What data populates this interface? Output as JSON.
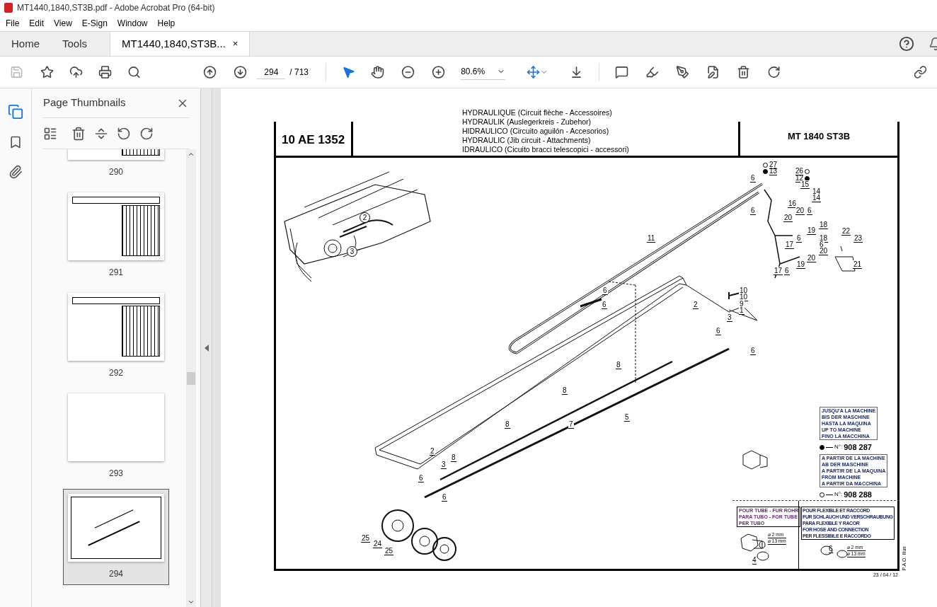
{
  "window": {
    "title": "MT1440,1840,ST3B.pdf - Adobe Acrobat Pro (64-bit)"
  },
  "menu": [
    "File",
    "Edit",
    "View",
    "E-Sign",
    "Window",
    "Help"
  ],
  "tabs": [
    {
      "label": "Home",
      "selected": false
    },
    {
      "label": "Tools",
      "selected": false
    },
    {
      "label": "MT1440,1840,ST3B...",
      "selected": true,
      "close": "×"
    }
  ],
  "toolbar": {
    "page": "294",
    "page_total": "/ 713",
    "zoom": "80.6%"
  },
  "sidebar": {
    "title": "Page Thumbnails",
    "thumbnails": [
      {
        "label": "290",
        "kind": "table",
        "selected": false
      },
      {
        "label": "291",
        "kind": "table",
        "selected": false
      },
      {
        "label": "292",
        "kind": "table",
        "selected": false
      },
      {
        "label": "293",
        "kind": "blank",
        "selected": false
      },
      {
        "label": "294",
        "kind": "drawing",
        "selected": true
      }
    ]
  },
  "document": {
    "ref": "10 AE 1352",
    "titles": [
      "HYDRAULIQUE (Circuit flèche - Accessoires)",
      "HYDRAULIK (Auslegerkreis - Zubehor)",
      "HIDRAULICO (Circuito aguilón - Accesorios)",
      "HYDRAULIC (Jib circuit - Attachments)",
      "IDRAULICO (Cicuito bracci telescopici - accessori)"
    ],
    "model": "MT 1840 ST3B",
    "part_labels": [
      {
        "text": "2",
        "kind": "circled"
      },
      {
        "text": "3",
        "kind": "circled"
      },
      {
        "text": "11",
        "kind": "plain"
      },
      {
        "text": "6",
        "kind": "plain"
      },
      {
        "text": "6",
        "kind": "plain"
      },
      {
        "text": "27",
        "kind": "open_dot"
      },
      {
        "text": "13",
        "kind": "filled_dot"
      },
      {
        "text": "26",
        "kind": "open_dot",
        "dot_after": true
      },
      {
        "text": "12",
        "kind": "filled_dot",
        "dot_after": true
      },
      {
        "text": "15",
        "kind": "plain"
      },
      {
        "text": "14",
        "kind": "plain"
      },
      {
        "text": "14",
        "kind": "plain"
      },
      {
        "text": "16",
        "kind": "plain"
      },
      {
        "text": "20",
        "kind": "plain"
      },
      {
        "text": "6",
        "kind": "plain"
      },
      {
        "text": "20",
        "kind": "plain"
      },
      {
        "text": "18",
        "kind": "plain"
      },
      {
        "text": "19",
        "kind": "plain"
      },
      {
        "text": "6",
        "kind": "plain"
      },
      {
        "text": "18",
        "kind": "plain"
      },
      {
        "text": "6",
        "kind": "plain"
      },
      {
        "text": "17",
        "kind": "plain"
      },
      {
        "text": "20",
        "kind": "plain"
      },
      {
        "text": "20",
        "kind": "plain"
      },
      {
        "text": "19",
        "kind": "plain"
      },
      {
        "text": "17",
        "kind": "plain"
      },
      {
        "text": "6",
        "kind": "plain"
      },
      {
        "text": "22",
        "kind": "plain"
      },
      {
        "text": "23",
        "kind": "plain"
      },
      {
        "text": "21",
        "kind": "plain"
      },
      {
        "text": "10",
        "kind": "plain"
      },
      {
        "text": "10",
        "kind": "plain"
      },
      {
        "text": "9",
        "kind": "plain"
      },
      {
        "text": "1",
        "kind": "plain"
      },
      {
        "text": "6",
        "kind": "plain"
      },
      {
        "text": "6",
        "kind": "plain"
      },
      {
        "text": "2",
        "kind": "plain"
      },
      {
        "text": "3",
        "kind": "plain"
      },
      {
        "text": "6",
        "kind": "plain"
      },
      {
        "text": "6",
        "kind": "plain"
      },
      {
        "text": "8",
        "kind": "plain"
      },
      {
        "text": "8",
        "kind": "plain"
      },
      {
        "text": "5",
        "kind": "plain"
      },
      {
        "text": "7",
        "kind": "plain"
      },
      {
        "text": "8",
        "kind": "plain"
      },
      {
        "text": "2",
        "kind": "plain"
      },
      {
        "text": "3",
        "kind": "plain"
      },
      {
        "text": "8",
        "kind": "plain"
      },
      {
        "text": "6",
        "kind": "plain"
      },
      {
        "text": "6",
        "kind": "plain"
      },
      {
        "text": "25",
        "kind": "plain"
      },
      {
        "text": "24",
        "kind": "plain"
      },
      {
        "text": "25",
        "kind": "plain"
      }
    ],
    "legend_up": {
      "lines": [
        "JUSQU'A LA MACHINE",
        "BIS DER MASCHINE",
        "HASTA LA MAQUINA",
        "UP TO MACHINE",
        "FINO LA MACCHINA"
      ],
      "prefix": "N°:",
      "number": "908 287"
    },
    "legend_from": {
      "lines": [
        "A PARTIR DE LA MACHINE",
        "AB DER MASCHINE",
        "A PARTIR DE LA MAQUINA",
        "FROM MACHINE",
        "A PARTIR DA MACCHINA"
      ],
      "prefix": "N°:",
      "number": "908 288"
    },
    "tube_box": {
      "lines": [
        "POUR TUBE - FUR ROHR",
        "PARA TUBO - FOR TUBE",
        "PER TUBO"
      ],
      "label": "4",
      "dims": [
        "⌀ 2 mm",
        "⌀ 13 mm"
      ]
    },
    "hose_box": {
      "lines": [
        "POUR FLEXIBLE ET RACCORD",
        "FUR SCHLAUCH UND VERSCHRAUBUNG",
        "PARA FLEXIBLE Y RACOR",
        "FOR HOSE AND CONNECTION",
        "PER FLESSIBILE E RACCORDO"
      ],
      "label": "6",
      "dims": [
        "⌀ 2 mm",
        "⌀ 13 mm"
      ]
    },
    "date": "23 / 04 / 12",
    "credit": "P.A.O. Illus"
  }
}
